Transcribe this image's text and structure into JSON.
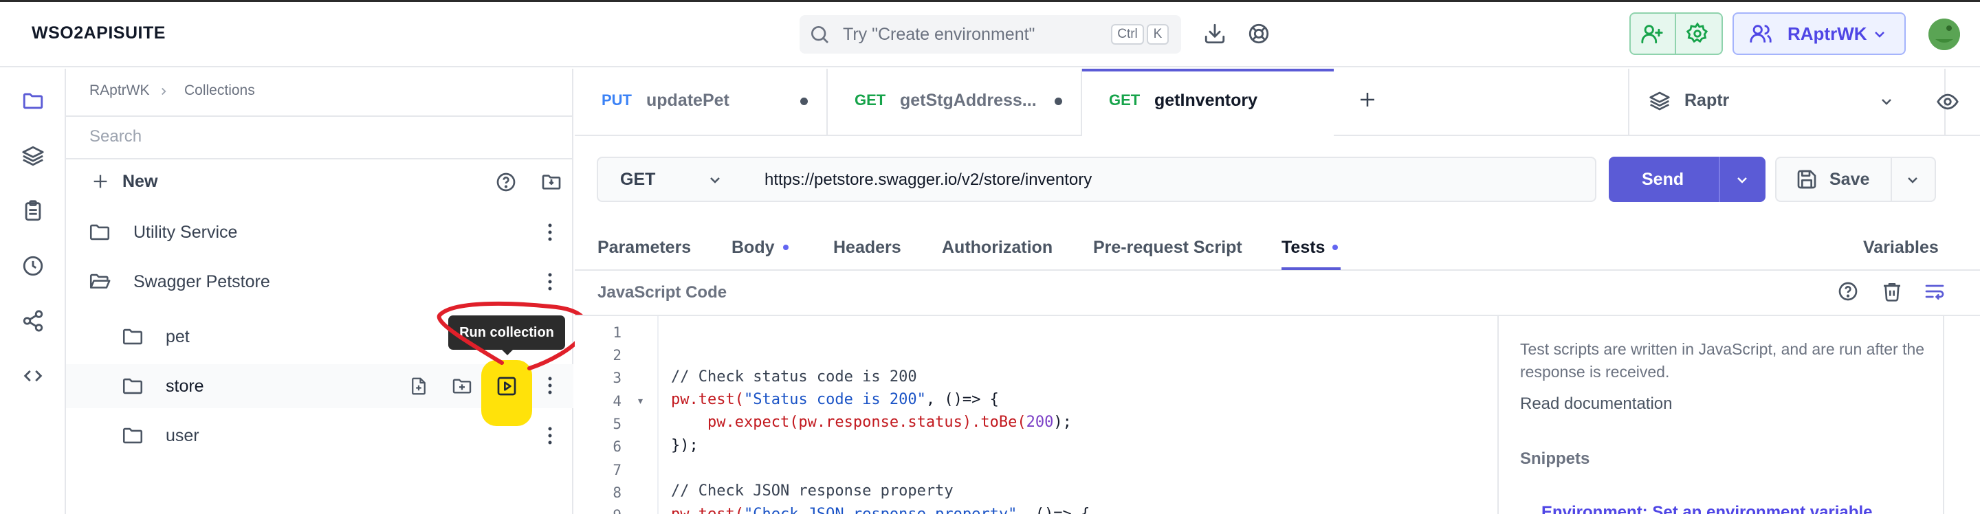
{
  "app": {
    "brand": "WSO2APISUITE",
    "search": {
      "placeholder": "Try \"Create environment\"",
      "shortcut_ctrl": "Ctrl",
      "shortcut_key": "K"
    },
    "workspace": "RAptrWK",
    "accent_color": "#5b5bd6"
  },
  "rail": {
    "icons": [
      "folder-icon",
      "layers-icon",
      "clipboard-icon",
      "history-icon",
      "share-icon",
      "code-icon"
    ]
  },
  "sidebar": {
    "breadcrumb": [
      "RAptrWK",
      "Collections"
    ],
    "search_placeholder": "Search",
    "new_label": "New",
    "tree": [
      {
        "label": "Utility Service",
        "level": 0
      },
      {
        "label": "Swagger Petstore",
        "level": 0
      },
      {
        "label": "pet",
        "level": 1
      },
      {
        "label": "store",
        "level": 1
      },
      {
        "label": "user",
        "level": 1
      }
    ],
    "tooltip": "Run collection"
  },
  "tabs": [
    {
      "method": "PUT",
      "name": "updatePet",
      "unsaved": true
    },
    {
      "method": "GET",
      "name": "getStgAddress...",
      "unsaved": true
    },
    {
      "method": "GET",
      "name": "getInventory",
      "unsaved": false,
      "active": true
    }
  ],
  "environment": "Raptr",
  "request": {
    "method": "GET",
    "url": "https://petstore.swagger.io/v2/store/inventory",
    "send_label": "Send",
    "save_label": "Save"
  },
  "request_tabs": [
    {
      "label": "Parameters"
    },
    {
      "label": "Body",
      "dot": true
    },
    {
      "label": "Headers"
    },
    {
      "label": "Authorization"
    },
    {
      "label": "Pre-request Script"
    },
    {
      "label": "Tests",
      "dot": true,
      "active": true
    }
  ],
  "variables_label": "Variables",
  "editor": {
    "title": "JavaScript Code",
    "line_numbers": [
      "1",
      "2",
      "3",
      "4",
      "5",
      "6",
      "7",
      "8",
      "9"
    ],
    "lines": [
      "",
      "",
      "// Check status code is 200",
      "pw.test(\"Status code is 200\", ()=> {",
      "    pw.expect(pw.response.status).toBe(200);",
      "});",
      "",
      "// Check JSON response property",
      "pw.test(\"Check JSON response property\", ()=> {"
    ]
  },
  "help_panel": {
    "text": "Test scripts are written in JavaScript, and are run after the response is received.",
    "read_docs": "Read documentation",
    "snippets_title": "Snippets",
    "snippet_first": "Environment: Set an environment variable"
  }
}
